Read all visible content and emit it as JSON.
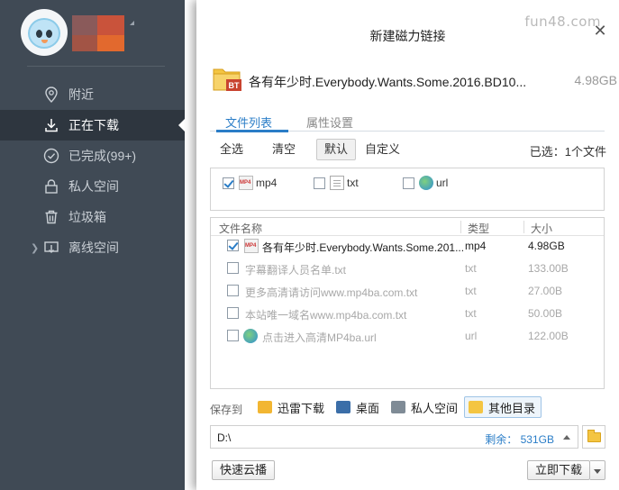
{
  "sidebar": {
    "items": [
      {
        "label": "附近",
        "icon": "location-pin-icon"
      },
      {
        "label": "正在下载",
        "icon": "download-icon",
        "active": true
      },
      {
        "label": "已完成(99+)",
        "icon": "check-circle-icon"
      },
      {
        "label": "私人空间",
        "icon": "lock-icon"
      },
      {
        "label": "垃圾箱",
        "icon": "trash-icon"
      },
      {
        "label": "离线空间",
        "icon": "cloud-download-icon"
      }
    ]
  },
  "dialog": {
    "watermark": "fun48.com",
    "title": "新建磁力链接",
    "torrent": {
      "name": "各有年少时.Everybody.Wants.Some.2016.BD10...",
      "size": "4.98GB",
      "badge": "BT"
    },
    "tabs": [
      {
        "label": "文件列表",
        "active": true
      },
      {
        "label": "属性设置",
        "active": false
      }
    ],
    "filters": {
      "select_all": "全选",
      "clear": "清空",
      "default": "默认",
      "custom": "自定义",
      "selected_count": "已选：1个文件"
    },
    "type_filters": [
      {
        "label": "mp4",
        "checked": true,
        "icon": "mp4-file-icon"
      },
      {
        "label": "txt",
        "checked": false,
        "icon": "txt-file-icon"
      },
      {
        "label": "url",
        "checked": false,
        "icon": "url-file-icon"
      }
    ],
    "columns": {
      "name": "文件名称",
      "type": "类型",
      "size": "大小"
    },
    "files": [
      {
        "name": "各有年少时.Everybody.Wants.Some.201...",
        "type": "mp4",
        "size": "4.98GB",
        "checked": true
      },
      {
        "name": "字幕翻译人员名单.txt",
        "type": "txt",
        "size": "133.00B",
        "checked": false
      },
      {
        "name": "更多高清请访问www.mp4ba.com.txt",
        "type": "txt",
        "size": "27.00B",
        "checked": false
      },
      {
        "name": "本站唯一域名www.mp4ba.com.txt",
        "type": "txt",
        "size": "50.00B",
        "checked": false
      },
      {
        "name": "点击进入高清MP4ba.url",
        "type": "url",
        "size": "122.00B",
        "checked": false
      }
    ],
    "save": {
      "label": "保存到",
      "options": [
        {
          "label": "迅雷下载",
          "color": "#f2b632"
        },
        {
          "label": "桌面",
          "color": "#3b6ea8"
        },
        {
          "label": "私人空间",
          "color": "#7f8b96"
        },
        {
          "label": "其他目录",
          "color": "#f4c542",
          "active": true
        }
      ]
    },
    "path": {
      "value": "D:\\",
      "free_space": "剩余： 531GB"
    },
    "buttons": {
      "cloud_play": "快速云播",
      "download_now": "立即下载"
    }
  },
  "colors": {
    "accent": "#2a7dc7",
    "sidebar_bg": "#404a55",
    "sidebar_active": "#2e363f"
  }
}
